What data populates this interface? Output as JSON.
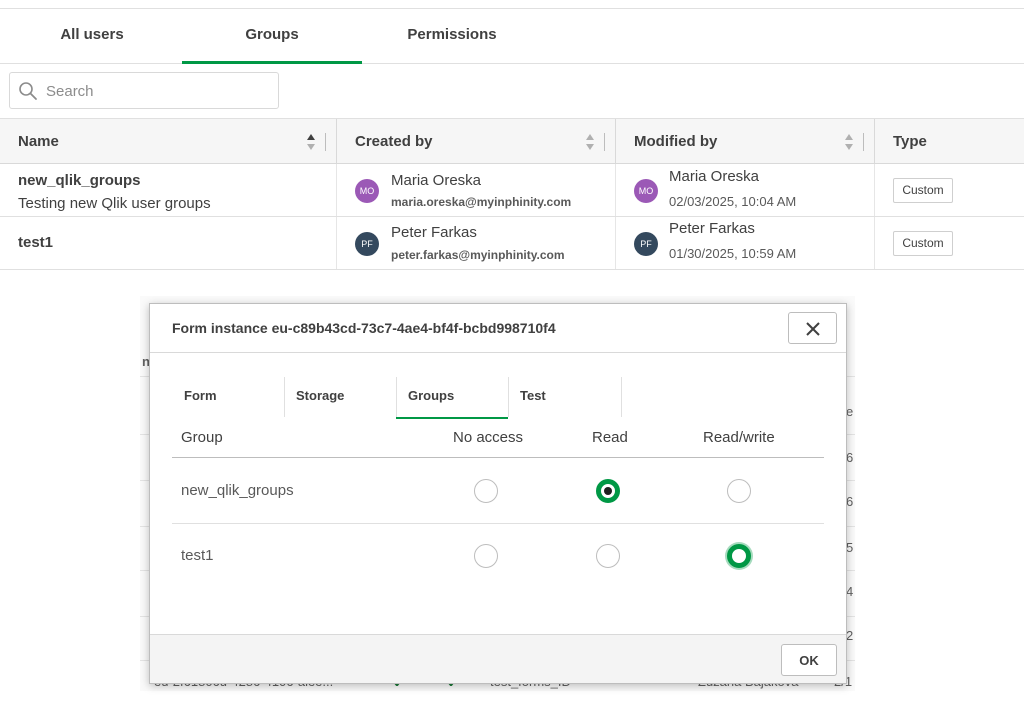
{
  "tabs": [
    {
      "label": "All users"
    },
    {
      "label": "Groups",
      "active": true
    },
    {
      "label": "Permissions"
    }
  ],
  "search": {
    "placeholder": "Search",
    "value": ""
  },
  "table": {
    "columns": [
      "Name",
      "Created by",
      "Modified by",
      "Type"
    ],
    "rows": [
      {
        "name": "new_qlik_groups",
        "description": "Testing new Qlik user groups",
        "created_by": {
          "initials": "MO",
          "name": "Maria Oreska",
          "email": "maria.oreska@myinphinity.com",
          "color": "#8e44ad"
        },
        "modified_by": {
          "initials": "MO",
          "name": "Maria Oreska",
          "date": "02/03/2025, 10:04 AM",
          "color": "#8e44ad"
        },
        "type": "Custom"
      },
      {
        "name": "test1",
        "description": "",
        "created_by": {
          "initials": "PF",
          "name": "Peter Farkas",
          "email": "peter.farkas@myinphinity.com",
          "color": "#34495e"
        },
        "modified_by": {
          "initials": "PF",
          "name": "Peter Farkas",
          "date": "01/30/2025, 10:59 AM",
          "color": "#34495e"
        },
        "type": "Custom"
      }
    ]
  },
  "background": {
    "left_fragment": "n",
    "right_fragments": [
      "e",
      "6",
      "6",
      "5",
      "4",
      "2",
      "2/1"
    ],
    "bottom_fragments": [
      "eu-2f61806u-4286-4106-alee...",
      "test_forms_ID",
      "Zuzana Bajakova"
    ]
  },
  "dialog": {
    "title": "Form instance eu-c89b43cd-73c7-4ae4-bf4f-bcbd998710f4",
    "tabs": [
      {
        "label": "Form"
      },
      {
        "label": "Storage"
      },
      {
        "label": "Groups",
        "active": true
      },
      {
        "label": "Test"
      }
    ],
    "permission_headers": {
      "group": "Group",
      "no_access": "No access",
      "read": "Read",
      "read_write": "Read/write"
    },
    "permissions": [
      {
        "group": "new_qlik_groups",
        "selected": "read"
      },
      {
        "group": "test1",
        "selected": "read_write"
      }
    ],
    "ok_label": "OK"
  },
  "colors": {
    "accent": "#009845"
  }
}
